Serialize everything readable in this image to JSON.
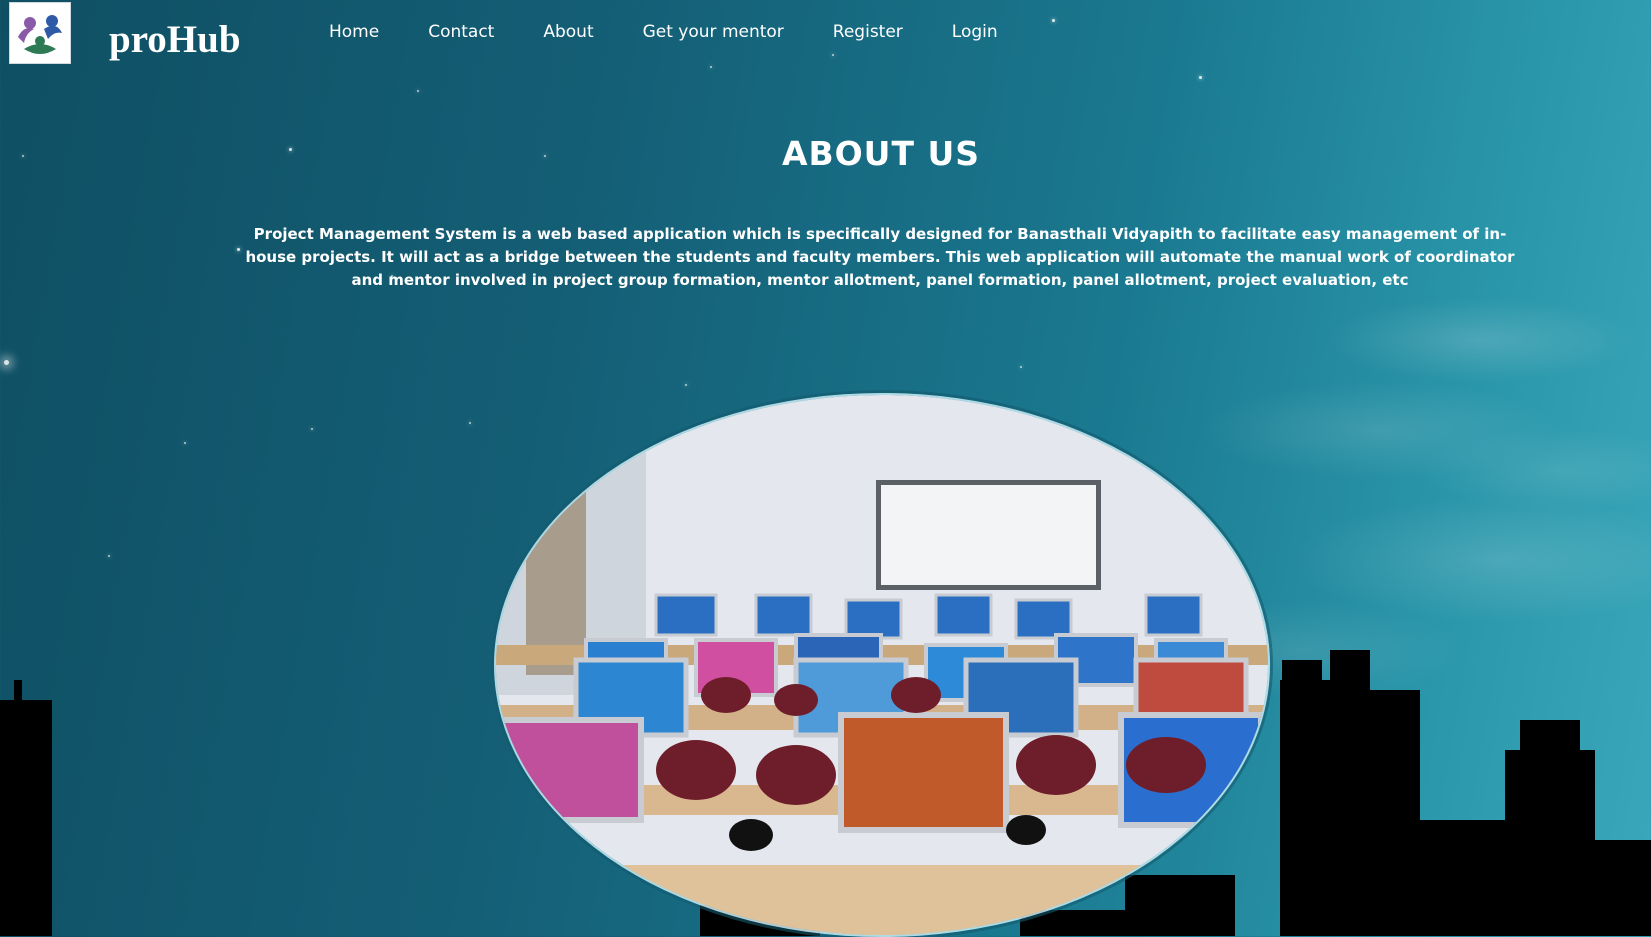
{
  "brand": {
    "name": "proHub",
    "logo_icon": "people-circle-logo-icon"
  },
  "nav": {
    "items": [
      {
        "label": "Home"
      },
      {
        "label": "Contact"
      },
      {
        "label": "About"
      },
      {
        "label": "Get your mentor"
      },
      {
        "label": "Register"
      },
      {
        "label": "Login"
      }
    ]
  },
  "about": {
    "heading": "ABOUT US",
    "text": "Project Management System is a web based application which is specifically designed for Banasthali Vidyapith to facilitate easy management of in-house projects. It will act as a bridge between the students and faculty members. This web application will automate the manual work of coordinator and mentor involved in project group formation, mentor allotment, panel formation, panel allotment, project evaluation, etc"
  },
  "image": {
    "subject": "computer-lab-photo"
  },
  "colors": {
    "background": "#145f76",
    "text": "#ffffff",
    "skyline": "#000000"
  }
}
